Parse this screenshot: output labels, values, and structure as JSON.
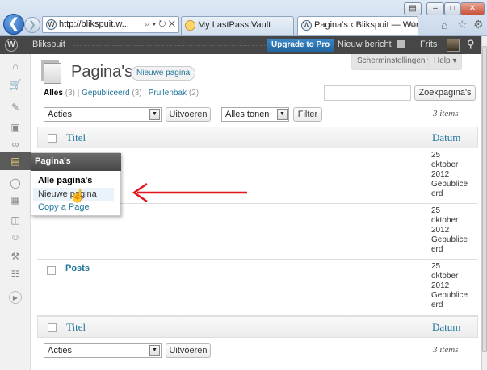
{
  "browser": {
    "address": "http://blikspuit.w...",
    "address_tools": "⌕ ▾ ↻ ✕",
    "tabs": [
      {
        "label": "My LastPass Vault"
      },
      {
        "label": "Pagina's ‹ Blikspuit — Word...",
        "close": "✕"
      }
    ],
    "window_buttons": [
      "–",
      "□",
      "✕"
    ]
  },
  "adminbar": {
    "site_name": "Blikspuit",
    "upgrade": "Upgrade to Pro",
    "new_post": "Nieuw bericht",
    "user": "Frits"
  },
  "page": {
    "title": "Pagina's",
    "add_new": "Nieuwe pagina",
    "screen_options": "Scherminstellingen ▾",
    "help": "Help ▾",
    "filters": {
      "all": "Alles",
      "all_count": "(3)",
      "separator": "|",
      "published": "Gepubliceerd",
      "published_count": "(3)",
      "trash": "Prullenbak",
      "trash_count": "(2)"
    },
    "search_button": "Zoekpagina's",
    "bulk_action": "Acties",
    "apply": "Uitvoeren",
    "date_filter": "Alles tonen",
    "filter_button": "Filter",
    "items": "3 items",
    "col_title": "Titel",
    "col_date": "Datum"
  },
  "rows": [
    {
      "title": "",
      "date": [
        "25",
        "oktober",
        "2012",
        "Gepublice",
        "erd"
      ]
    },
    {
      "title": "",
      "date": [
        "25",
        "oktober",
        "2012",
        "Gepublice",
        "erd"
      ]
    },
    {
      "title": "Posts",
      "date": [
        "25",
        "oktober",
        "2012",
        "Gepublice",
        "erd"
      ]
    }
  ],
  "flyout": {
    "header": "Pagina's",
    "items": [
      "Alle pagina's",
      "Nieuwe pagina",
      "Copy a Page"
    ]
  },
  "accent_color": "#21759b",
  "arrow_color": "#e0161a"
}
